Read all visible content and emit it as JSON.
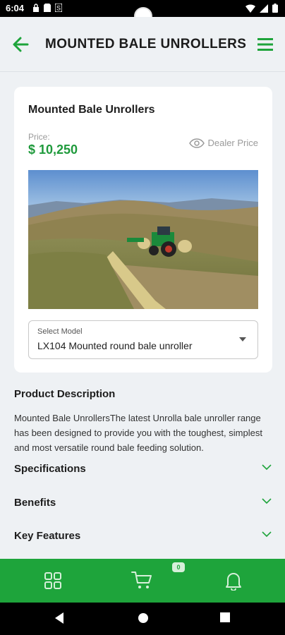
{
  "status_bar": {
    "time": "6:04",
    "left_icons": [
      "lock-icon",
      "sd-card-icon",
      "s-icon"
    ],
    "right_icons": [
      "wifi-icon",
      "signal-icon",
      "battery-icon"
    ]
  },
  "header": {
    "title": "MOUNTED BALE UNROLLERS",
    "back_icon": "arrow-left-icon",
    "menu_icon": "hamburger-menu-icon"
  },
  "product": {
    "title": "Mounted Bale Unrollers",
    "price_label": "Price:",
    "price": "$ 10,250",
    "dealer_price_label": "Dealer Price",
    "image_alt": "Tractor with mounted bale unroller spreading hay on a hillside",
    "select_label": "Select Model",
    "select_value": "LX104 Mounted round bale unroller"
  },
  "description": {
    "title": "Product Description",
    "text": "Mounted Bale UnrollersThe latest Unrolla bale unroller range has been designed to provide you with the toughest, simplest and most versatile round bale feeding solution."
  },
  "accordions": [
    {
      "label": "Specifications"
    },
    {
      "label": "Benefits"
    },
    {
      "label": "Key Features"
    }
  ],
  "bottom_nav": {
    "items": [
      "grid-icon",
      "cart-icon",
      "bell-icon"
    ],
    "cart_count": "0"
  },
  "colors": {
    "accent": "#1ea43b",
    "price": "#1f9a3c",
    "background": "#eef1f4"
  }
}
